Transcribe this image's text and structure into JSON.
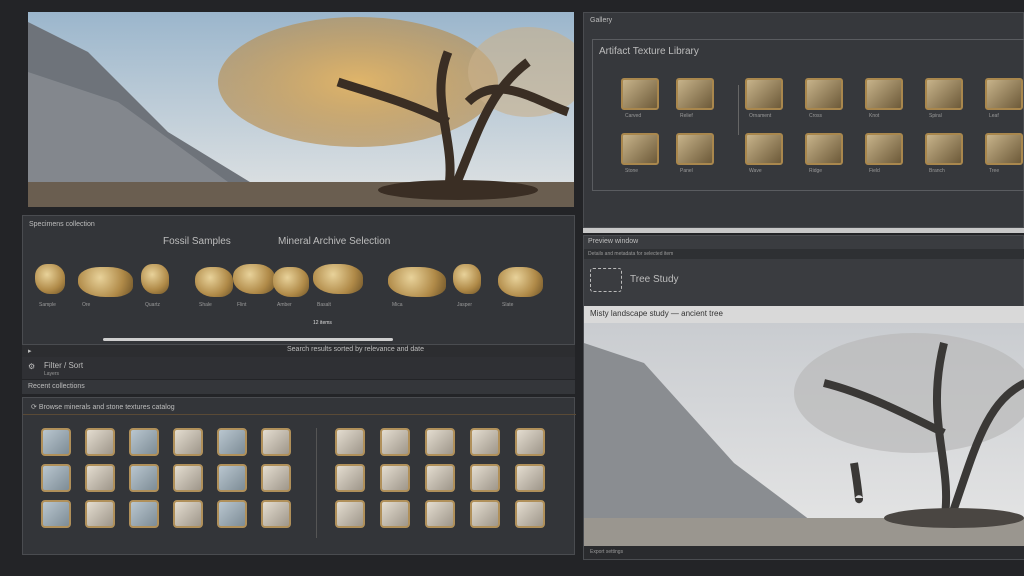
{
  "top_left": {
    "scene": "golden-tree-landscape"
  },
  "rock_panel": {
    "header": "Specimens collection",
    "title_a": "Fossil Samples",
    "title_b": "Mineral Archive Selection",
    "center_caption": "12 items",
    "rocks": [
      "Sample",
      "Ore",
      "Quartz",
      "Shale",
      "Flint",
      "Amber",
      "Basalt",
      "Mica",
      "Jasper",
      "Slate"
    ],
    "status": "Search results sorted by relevance and date"
  },
  "row_tools": {
    "label": "Filter / Sort",
    "sub": "Layers"
  },
  "row_label": {
    "text": "Recent collections"
  },
  "grid_panel": {
    "header": "Browse minerals and stone textures catalog"
  },
  "right_top": {
    "header": "Gallery",
    "title": "Artifact Texture Library",
    "thumbs": [
      "Carved",
      "Relief",
      "Ornament",
      "Cross",
      "Knot",
      "Spiral",
      "Leaf",
      "Stone",
      "Panel",
      "Wave",
      "Ridge",
      "Field",
      "Branch",
      "Tree"
    ]
  },
  "right_bottom": {
    "header": "Preview window",
    "sub": "Details and metadata for selected item",
    "logo_text": "Tree Study",
    "caption": "Misty landscape study — ancient tree",
    "footer": "Export settings"
  },
  "colors": {
    "bg": "#232427",
    "panel": "#333539",
    "accent": "#a9874d"
  }
}
